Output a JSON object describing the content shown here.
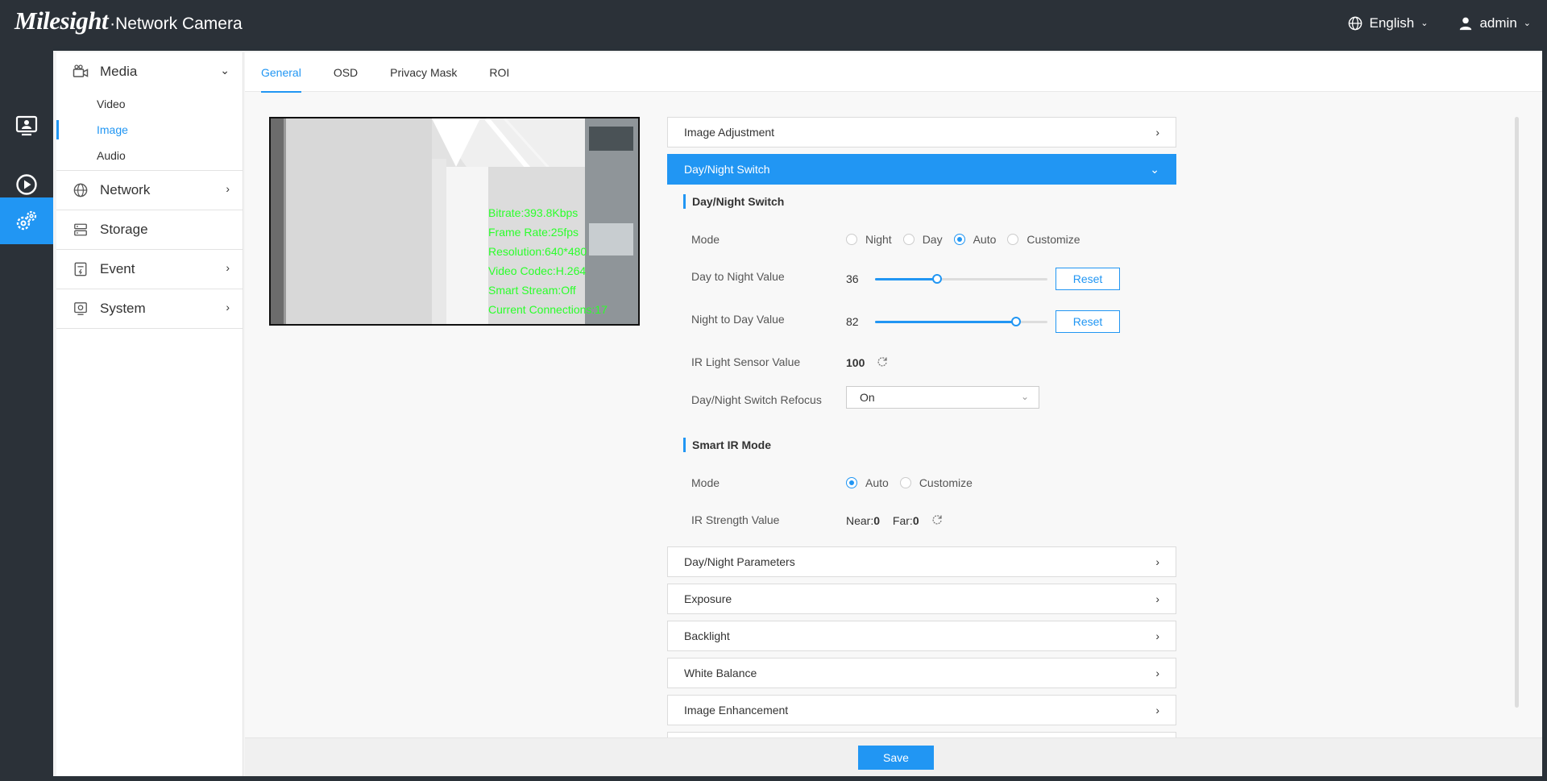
{
  "header": {
    "logo": "Milesight",
    "product": "·Network Camera",
    "language": "English",
    "user": "admin"
  },
  "rail": {
    "items": [
      {
        "icon": "live-view-icon"
      },
      {
        "icon": "playback-icon"
      },
      {
        "icon": "settings-icon",
        "active": true
      }
    ]
  },
  "menu": {
    "media": {
      "label": "Media",
      "subs": [
        "Video",
        "Image",
        "Audio"
      ]
    },
    "network": {
      "label": "Network"
    },
    "storage": {
      "label": "Storage"
    },
    "event": {
      "label": "Event"
    },
    "system": {
      "label": "System"
    }
  },
  "tabs": [
    "General",
    "OSD",
    "Privacy Mask",
    "ROI"
  ],
  "preview": {
    "osd": [
      "Bitrate:393.8Kbps",
      "Frame Rate:25fps",
      "Resolution:640*480",
      "Video Codec:H.264",
      "Smart Stream:Off",
      "Current Connections:17"
    ]
  },
  "accordion": {
    "image_adjustment": "Image Adjustment",
    "day_night_switch": "Day/Night Switch",
    "day_night_parameters": "Day/Night Parameters",
    "exposure": "Exposure",
    "backlight": "Backlight",
    "white_balance": "White Balance",
    "image_enhancement": "Image Enhancement"
  },
  "day_night": {
    "section_title": "Day/Night Switch",
    "mode_label": "Mode",
    "modes": [
      "Night",
      "Day",
      "Auto",
      "Customize"
    ],
    "selected_mode": "Auto",
    "d2n_label": "Day to Night Value",
    "d2n_value": "36",
    "d2n_level": 0.36,
    "n2d_label": "Night to Day Value",
    "n2d_value": "82",
    "n2d_level": 0.82,
    "reset": "Reset",
    "ir_label": "IR Light Sensor Value",
    "ir_value": "100",
    "refocus_label": "Day/Night Switch Refocus",
    "refocus_value": "On"
  },
  "smart_ir": {
    "section_title": "Smart IR Mode",
    "mode_label": "Mode",
    "modes": [
      "Auto",
      "Customize"
    ],
    "selected_mode": "Auto",
    "strength_label": "IR Strength Value",
    "near_label": "Near:",
    "near_value": "0",
    "far_label": "Far:",
    "far_value": "0"
  },
  "footer": {
    "save": "Save"
  }
}
